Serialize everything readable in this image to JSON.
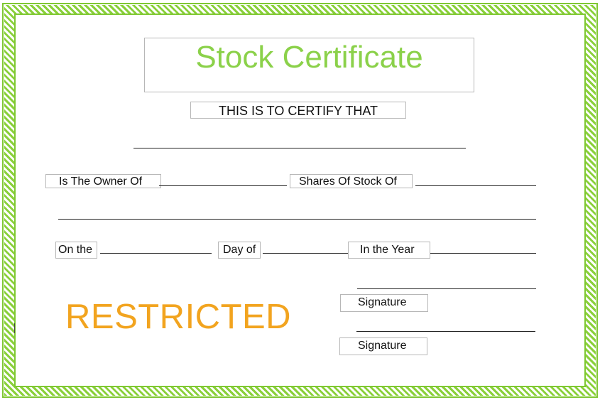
{
  "certificate": {
    "title": "Stock Certificate",
    "certify_text": "THIS IS TO CERTIFY THAT",
    "owner_label": "Is The Owner Of",
    "shares_label": "Shares Of Stock Of",
    "on_the_label": "On the",
    "day_of_label": "Day of",
    "year_label": "In the Year",
    "signature_label_1": "Signature",
    "signature_label_2": "Signature",
    "watermark": "RESTRICTED"
  },
  "colors": {
    "border": "#8ad03a",
    "title": "#8bd14a",
    "watermark": "#f2a41f"
  }
}
